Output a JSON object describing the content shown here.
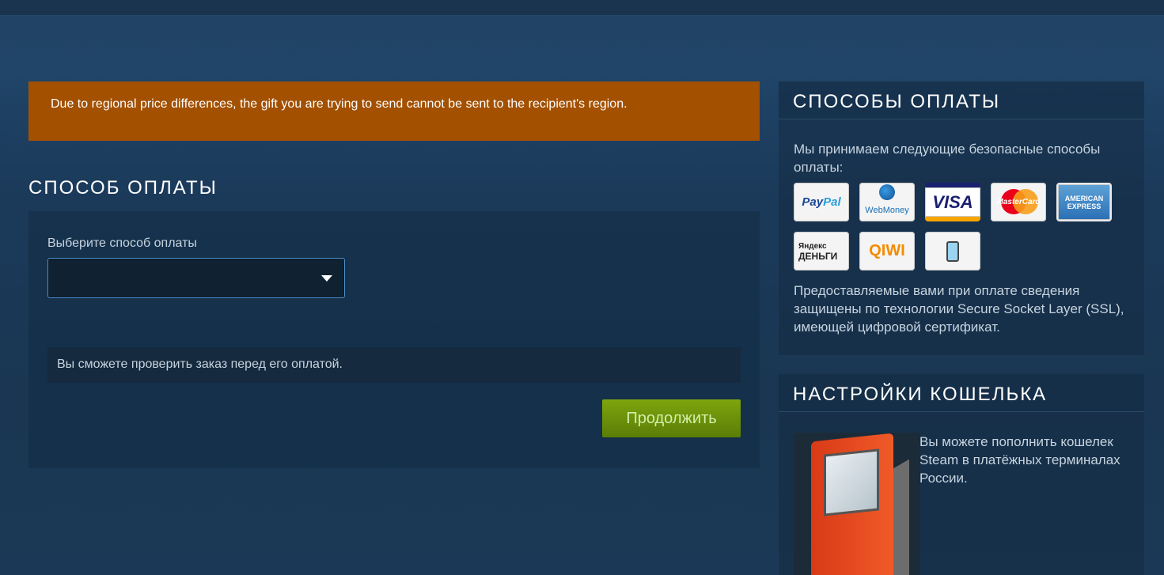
{
  "alert": {
    "message": "Due to regional price differences, the gift you are trying to send cannot be sent to the recipient's region."
  },
  "payment": {
    "title": "СПОСОБ ОПЛАТЫ",
    "select_label": "Выберите способ оплаты",
    "selected_value": "",
    "notice": "Вы сможете проверить заказ перед его оплатой.",
    "continue_label": "Продолжить",
    "continue_color": "#7ea50d"
  },
  "methods": {
    "title": "СПОСОБЫ ОПЛАТЫ",
    "intro": "Мы принимаем следующие безопасные способы оплаты:",
    "logos": [
      {
        "name": "paypal",
        "text_a": "Pay",
        "text_b": "Pal"
      },
      {
        "name": "webmoney",
        "text": "WebMoney"
      },
      {
        "name": "visa",
        "text": "VISA"
      },
      {
        "name": "mastercard",
        "text": "MasterCard"
      },
      {
        "name": "amex",
        "text_a": "AMERICAN",
        "text_b": "EXPRESS"
      },
      {
        "name": "yandex",
        "text_a": "Яндекс",
        "text_b": "ДЕНЬГИ"
      },
      {
        "name": "qiwi",
        "text": "QIWI"
      },
      {
        "name": "mobile",
        "icon": "mobile-phone-icon"
      }
    ],
    "ssl_text": "Предоставляемые вами при оплате сведения защищены по технологии Secure Socket Layer (SSL), имеющей цифровой сертификат."
  },
  "wallet": {
    "title": "НАСТРОЙКИ КОШЕЛЬКА",
    "text": "Вы можете пополнить кошелек Steam в платёжных терминалах России."
  },
  "colors": {
    "alert_bg": "#a35000",
    "select_border": "#4d8ec9",
    "background": "#1b3a5a"
  }
}
